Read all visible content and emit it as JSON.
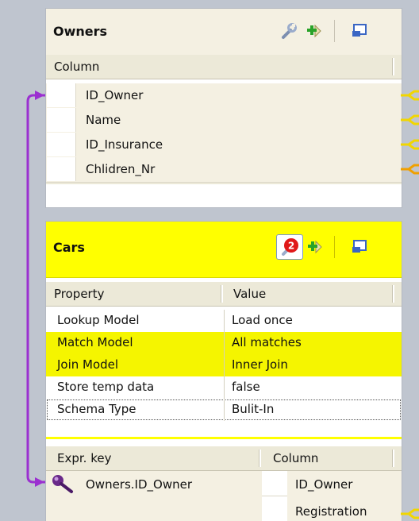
{
  "owners": {
    "title": "Owners",
    "header": "Column",
    "rows": [
      {
        "label": "ID_Owner"
      },
      {
        "label": "Name"
      },
      {
        "label": "ID_Insurance"
      },
      {
        "label": "Chlidren_Nr"
      }
    ]
  },
  "cars": {
    "title": "Cars",
    "badge_count": "2",
    "props_header": {
      "property": "Property",
      "value": "Value"
    },
    "props": [
      {
        "name": "Lookup Model",
        "value": "Load once"
      },
      {
        "name": "Match Model",
        "value": "All matches"
      },
      {
        "name": "Join Model",
        "value": "Inner Join"
      },
      {
        "name": "Store temp data",
        "value": "false"
      },
      {
        "name": "Schema Type",
        "value": "Bulit-In"
      }
    ],
    "expr_header": {
      "expr": "Expr. key",
      "column": "Column"
    },
    "expr_rows": [
      {
        "expr": "Owners.ID_Owner",
        "column": "ID_Owner"
      },
      {
        "expr": "",
        "column": "Registration"
      }
    ]
  },
  "icons": {
    "wrench": "wrench-icon",
    "add_input": "add-input-icon",
    "minimize": "minimize-window-icon",
    "key": "key-icon",
    "error_badge": "error-badge-icon"
  },
  "colors": {
    "highlight": "#ffff00",
    "link_purple": "#9b30d0",
    "link_yellow": "#f2d600",
    "link_orange": "#f0a000"
  }
}
